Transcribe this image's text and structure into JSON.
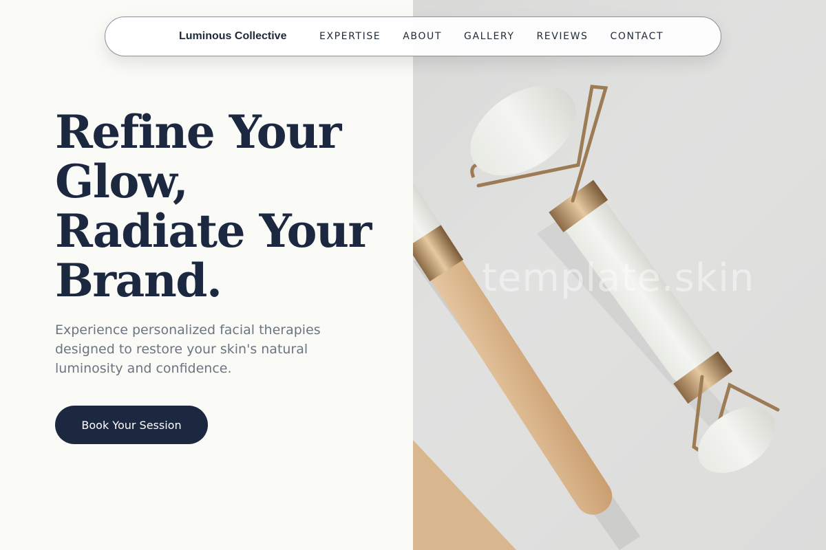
{
  "nav": {
    "brand": "Luminous Collective",
    "links": [
      "EXPERTISE",
      "ABOUT",
      "GALLERY",
      "REVIEWS",
      "CONTACT"
    ]
  },
  "hero": {
    "title_lines": [
      "Refine Your",
      "Glow,",
      "Radiate Your",
      "Brand."
    ],
    "subtitle": "Experience personalized facial therapies designed to restore your skin's natural luminosity and confidence.",
    "cta_label": "Book Your Session"
  },
  "image": {
    "subject": "jade-face-roller-photo",
    "watermark": "template.skin"
  },
  "colors": {
    "navy": "#1b2840",
    "background": "#fafaf7",
    "muted_text": "#6b7480"
  }
}
